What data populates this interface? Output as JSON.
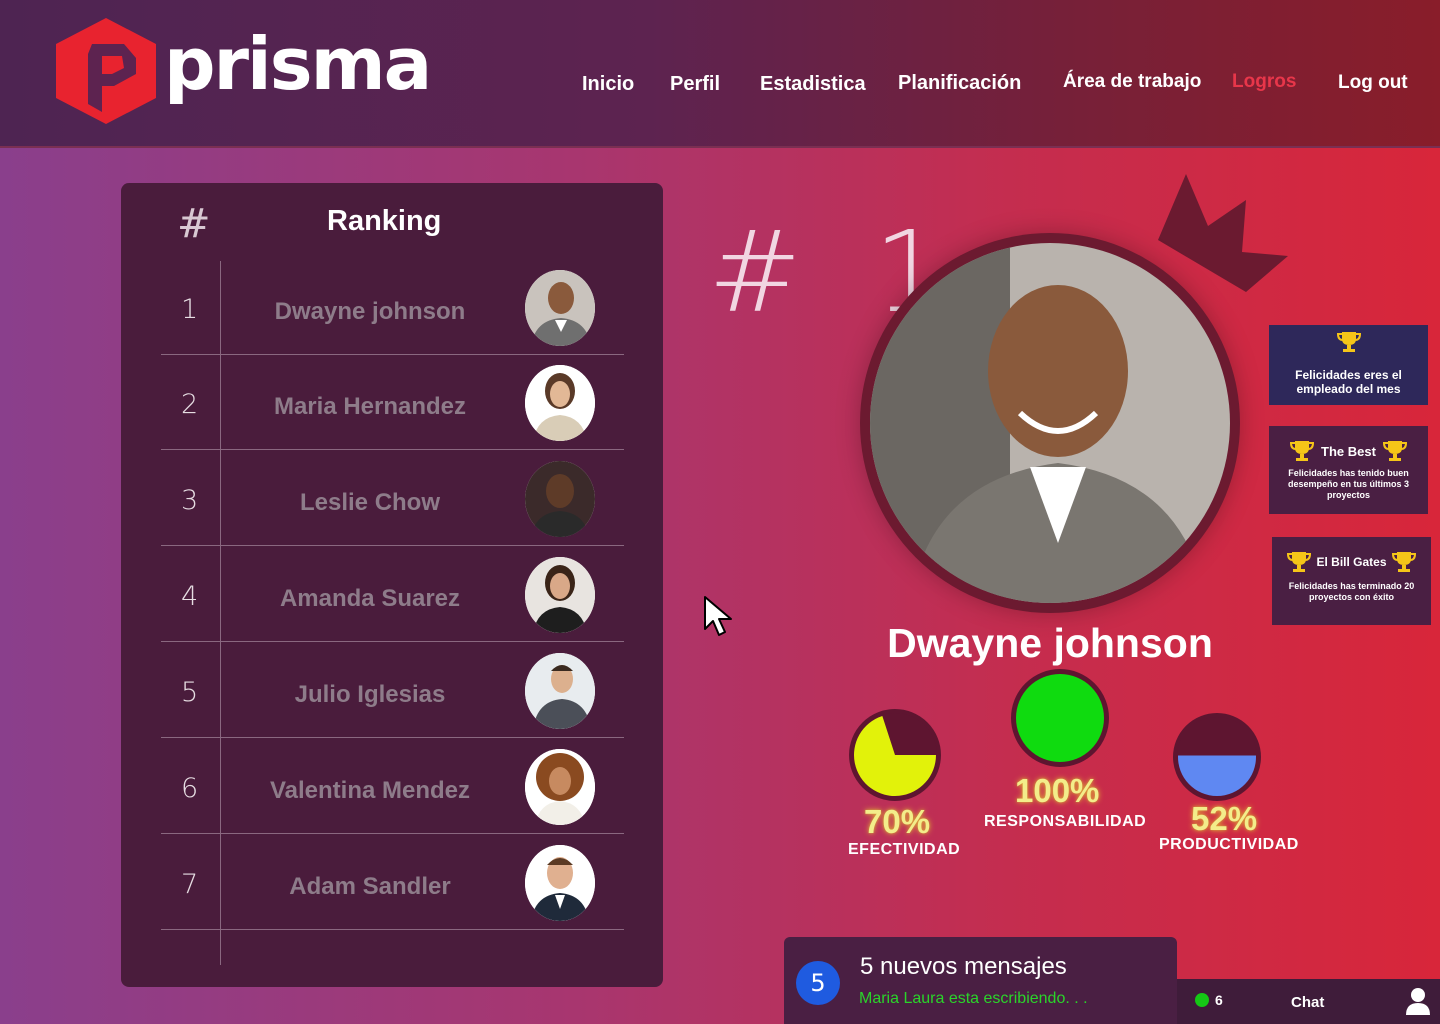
{
  "brand": {
    "name": "prisma",
    "logo_color": "#e8232f"
  },
  "nav": {
    "items": [
      {
        "label": "Inicio"
      },
      {
        "label": "Perfil"
      },
      {
        "label": "Estadistica"
      },
      {
        "label": "Planificación"
      },
      {
        "label": "Área de trabajo"
      },
      {
        "label": "Logros",
        "active": true
      },
      {
        "label": "Log out"
      }
    ]
  },
  "ranking": {
    "hash_header": "#",
    "title": "Ranking",
    "rows": [
      {
        "rank": "1",
        "name": "Dwayne johnson"
      },
      {
        "rank": "2",
        "name": "Maria Hernandez"
      },
      {
        "rank": "3",
        "name": "Leslie Chow"
      },
      {
        "rank": "4",
        "name": "Amanda Suarez"
      },
      {
        "rank": "5",
        "name": "Julio Iglesias"
      },
      {
        "rank": "6",
        "name": "Valentina Mendez"
      },
      {
        "rank": "7",
        "name": "Adam Sandler"
      }
    ]
  },
  "winner": {
    "rank_label": "# 1",
    "name": "Dwayne johnson",
    "stats": [
      {
        "value": 0.7,
        "pct_label": "70%",
        "label": "EFECTIVIDAD",
        "color": "#e2f20a"
      },
      {
        "value": 1.0,
        "pct_label": "100%",
        "label": "RESPONSABILIDAD",
        "color": "#0fdb0f"
      },
      {
        "value": 0.52,
        "pct_label": "52%",
        "label": "PRODUCTIVIDAD",
        "color": "#5f88f2"
      }
    ]
  },
  "achievements": [
    {
      "title": "",
      "text": "Felicidades eres el empleado del mes"
    },
    {
      "title": "The Best",
      "text": "Felicidades has tenido buen desempeño en tus últimos 3 proyectos"
    },
    {
      "title": "El Bill Gates",
      "text": "Felicidades has terminado 20 proyectos con éxito"
    }
  ],
  "chat": {
    "badge": "5",
    "title": "5 nuevos mensajes",
    "typing": "Maria Laura esta escribiendo. . .",
    "online_count": "6",
    "label": "Chat"
  }
}
